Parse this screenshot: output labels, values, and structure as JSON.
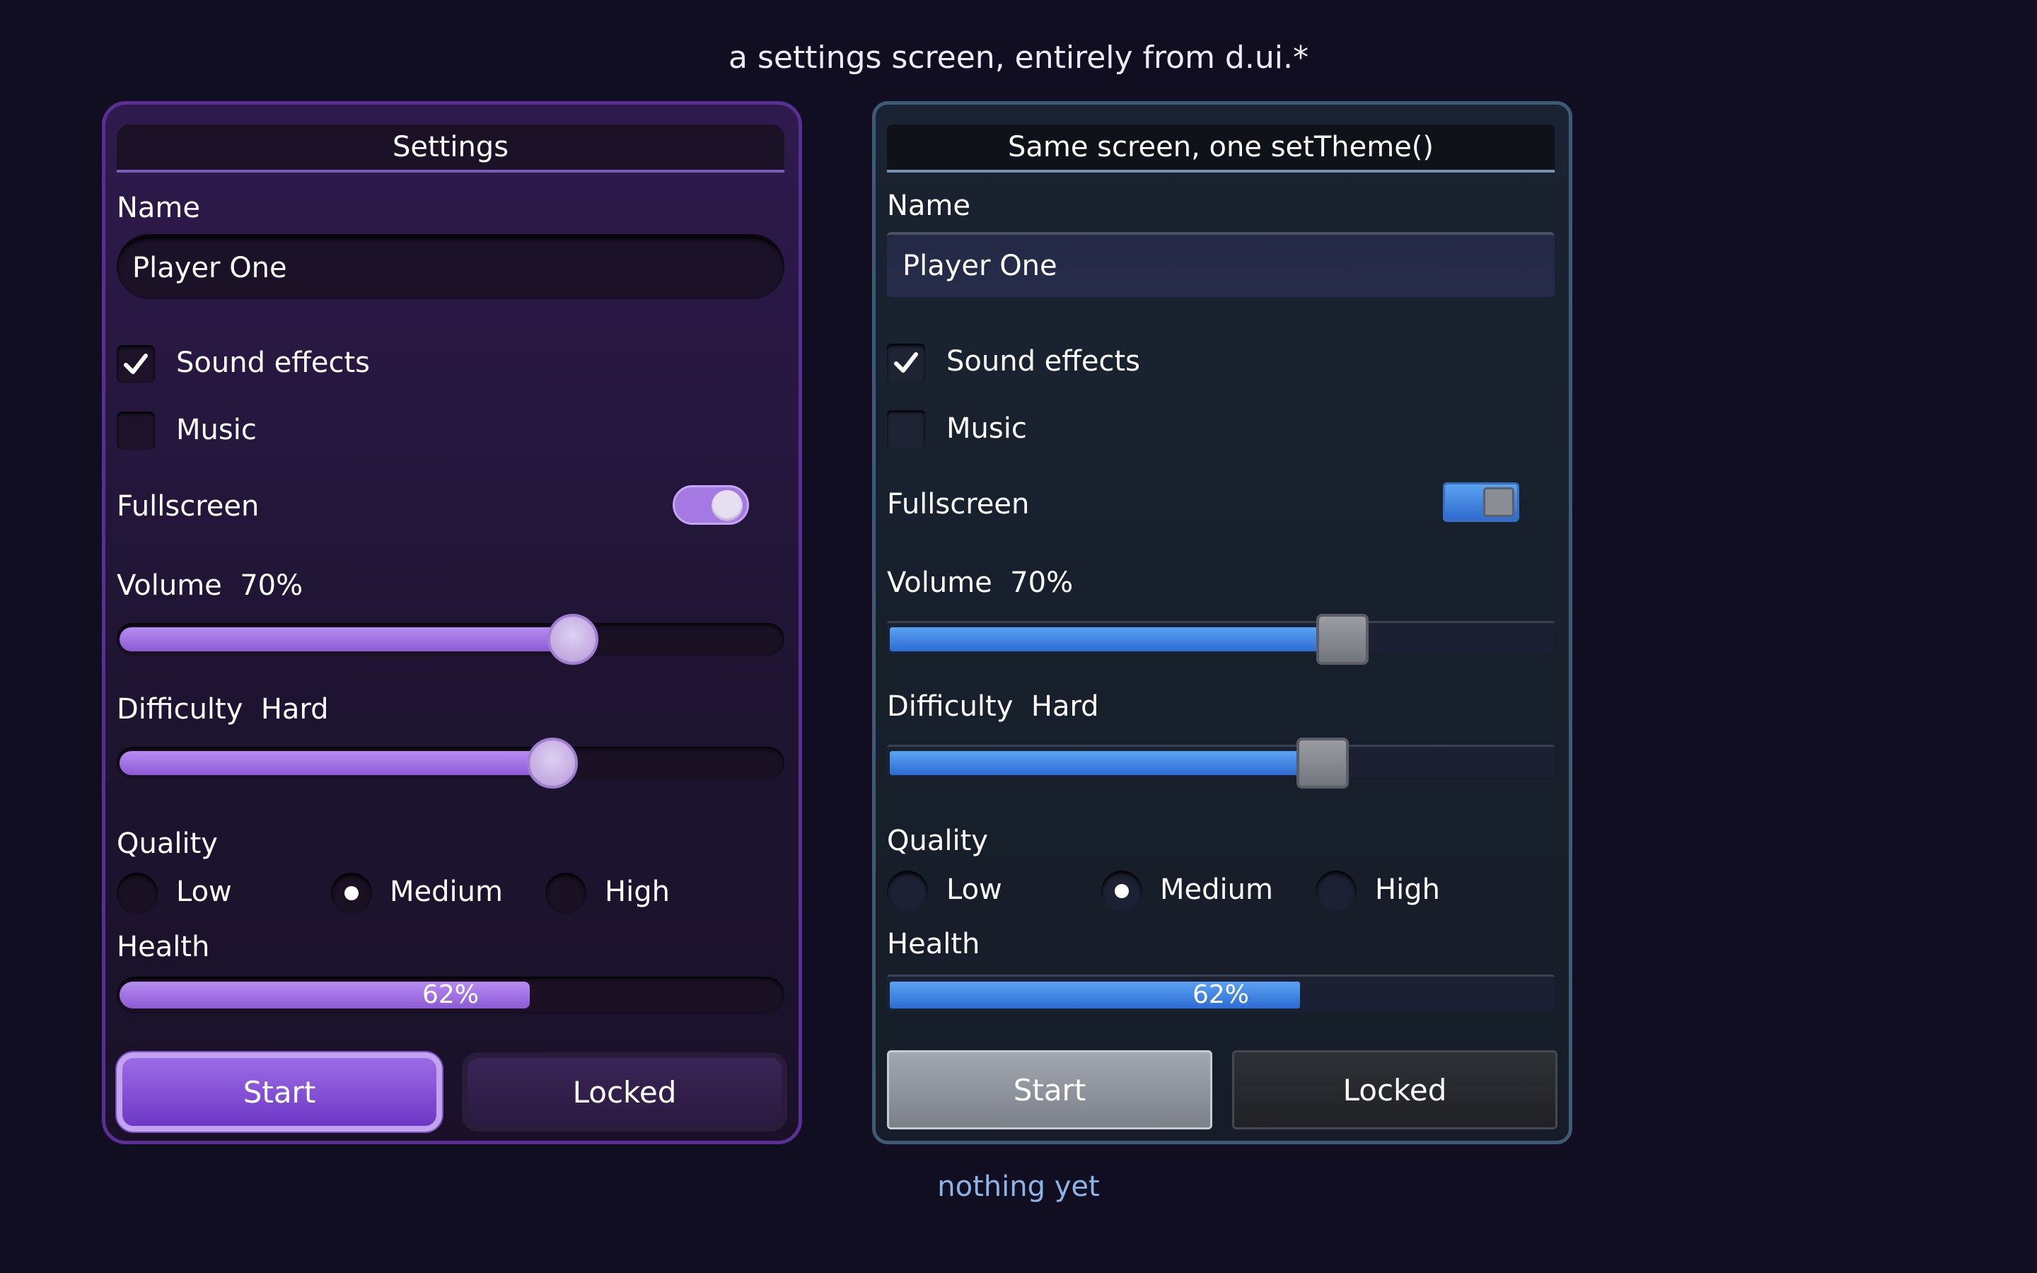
{
  "screen_title": "a settings screen, entirely from d.ui.*",
  "status_text": "nothing yet",
  "colors": {
    "background": "#120e22",
    "theme1_accent": "#a479e2",
    "theme1_border": "#5a2f95",
    "theme2_accent": "#3f86e6",
    "theme2_border": "#3f5a74",
    "status_text": "#8cb4e6"
  },
  "panels": [
    {
      "title": "Settings",
      "name_label": "Name",
      "name_value": "Player One",
      "sound_effects": {
        "label": "Sound effects",
        "checked": true
      },
      "music": {
        "label": "Music",
        "checked": false
      },
      "fullscreen": {
        "label": "Fullscreen",
        "on": true
      },
      "volume": {
        "label": "Volume",
        "value_text": "70%",
        "value": 0.7
      },
      "difficulty": {
        "label": "Difficulty",
        "value_text": "Hard",
        "value": 0.667
      },
      "quality": {
        "label": "Quality",
        "options": [
          "Low",
          "Medium",
          "High"
        ],
        "selected": "Medium"
      },
      "health": {
        "label": "Health",
        "value_text": "62%",
        "value": 0.62
      },
      "start_label": "Start",
      "locked_label": "Locked"
    },
    {
      "title": "Same screen, one setTheme()",
      "name_label": "Name",
      "name_value": "Player One",
      "sound_effects": {
        "label": "Sound effects",
        "checked": true
      },
      "music": {
        "label": "Music",
        "checked": false
      },
      "fullscreen": {
        "label": "Fullscreen",
        "on": true
      },
      "volume": {
        "label": "Volume",
        "value_text": "70%",
        "value": 0.7
      },
      "difficulty": {
        "label": "Difficulty",
        "value_text": "Hard",
        "value": 0.667
      },
      "quality": {
        "label": "Quality",
        "options": [
          "Low",
          "Medium",
          "High"
        ],
        "selected": "Medium"
      },
      "health": {
        "label": "Health",
        "value_text": "62%",
        "value": 0.62
      },
      "start_label": "Start",
      "locked_label": "Locked"
    }
  ]
}
